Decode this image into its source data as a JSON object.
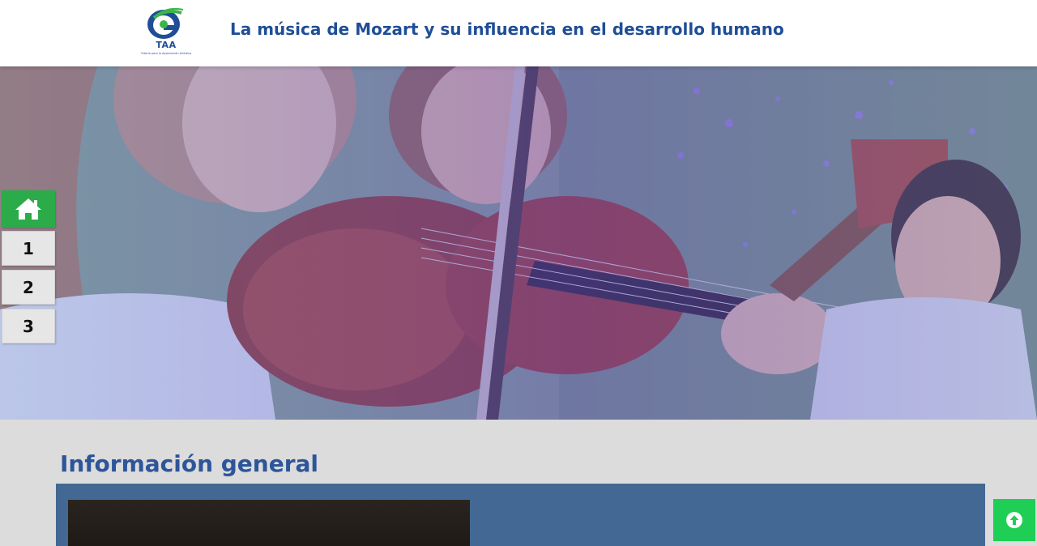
{
  "header": {
    "logo": {
      "text": "TAA",
      "subtitle": "Tutoría para la Apreciación Artística",
      "icon": "taa-logo-icon"
    },
    "title": "La música de Mozart y su influencia en el desarrollo humano"
  },
  "hero": {
    "image": "children-playing-violin-and-guitar"
  },
  "sidenav": {
    "home_icon": "home-icon",
    "items": [
      {
        "label": "1"
      },
      {
        "label": "2"
      },
      {
        "label": "3"
      }
    ]
  },
  "section": {
    "title": "Información general"
  },
  "back_to_top": {
    "icon": "arrow-up-circle-icon"
  },
  "colors": {
    "title_blue": "#1f4e96",
    "section_blue": "#2d5599",
    "panel_blue": "#436894",
    "home_green": "#2cab4a",
    "top_green": "#1fcf55",
    "background": "#dcdcdc"
  }
}
